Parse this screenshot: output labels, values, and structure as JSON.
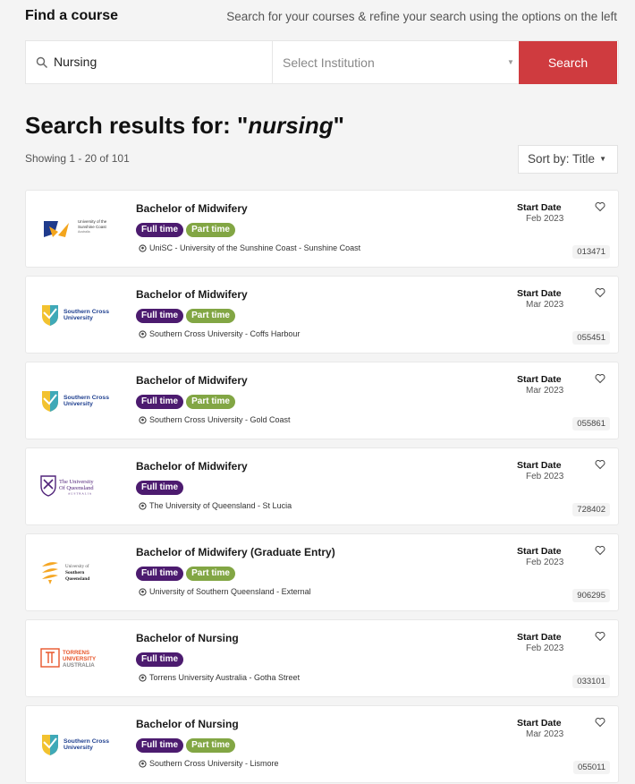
{
  "header": {
    "title": "Find a course",
    "subtitle": "Search for your courses & refine your search using the options on the left"
  },
  "search": {
    "icon": "search-icon",
    "query": "Nursing",
    "institution_placeholder": "Select Institution",
    "button": "Search"
  },
  "results": {
    "heading_prefix": "Search results for: \"",
    "term": "nursing",
    "heading_suffix": "\"",
    "showing": "Showing 1 - 20 of 101",
    "sort_label": "Sort by: Title"
  },
  "colors": {
    "accent": "#cf3b3f",
    "fulltime": "#4c1b6f",
    "parttime": "#82a644"
  },
  "courses": [
    {
      "title": "Bachelor of Midwifery",
      "full": "Full time",
      "part": "Part time",
      "location": "UniSC - University of the Sunshine Coast - Sunshine Coast",
      "start_label": "Start Date",
      "start": "Feb 2023",
      "code": "013471",
      "logo": {
        "l1": "University of the",
        "l2": "Sunshine Coast",
        "l3": "Australia"
      }
    },
    {
      "title": "Bachelor of Midwifery",
      "full": "Full time",
      "part": "Part time",
      "location": "Southern Cross University - Coffs Harbour",
      "start_label": "Start Date",
      "start": "Mar 2023",
      "code": "055451",
      "logo": {
        "l1": "Southern Cross",
        "l2": "University"
      }
    },
    {
      "title": "Bachelor of Midwifery",
      "full": "Full time",
      "part": "Part time",
      "location": "Southern Cross University - Gold Coast",
      "start_label": "Start Date",
      "start": "Mar 2023",
      "code": "055861",
      "logo": {
        "l1": "Southern Cross",
        "l2": "University"
      }
    },
    {
      "title": "Bachelor of Midwifery",
      "full": "Full time",
      "location": "The University of Queensland - St Lucia",
      "start_label": "Start Date",
      "start": "Feb 2023",
      "code": "728402",
      "logo": {
        "l1": "The University",
        "l2": "Of Queensland",
        "l3": "AUSTRALIA"
      }
    },
    {
      "title": "Bachelor of Midwifery (Graduate Entry)",
      "full": "Full time",
      "part": "Part time",
      "location": "University of Southern Queensland - External",
      "start_label": "Start Date",
      "start": "Feb 2023",
      "code": "906295",
      "logo": {
        "l1": "University of",
        "l2": "Southern",
        "l3": "Queensland"
      }
    },
    {
      "title": "Bachelor of Nursing",
      "full": "Full time",
      "location": "Torrens University Australia - Gotha Street",
      "start_label": "Start Date",
      "start": "Feb 2023",
      "code": "033101",
      "logo": {
        "l1": "TORRENS",
        "l2": "UNIVERSITY",
        "l3": "AUSTRALIA"
      }
    },
    {
      "title": "Bachelor of Nursing",
      "full": "Full time",
      "part": "Part time",
      "location": "Southern Cross University - Lismore",
      "start_label": "Start Date",
      "start": "Mar 2023",
      "code": "055011",
      "logo": {
        "l1": "Southern Cross",
        "l2": "University"
      }
    }
  ]
}
